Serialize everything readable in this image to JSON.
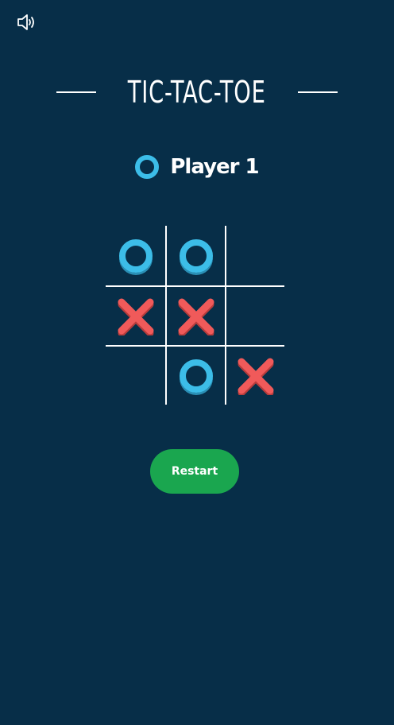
{
  "header": {
    "title": "TIC-TAC-TOE",
    "sound_icon": "speaker-volume-icon"
  },
  "turn": {
    "symbol": "O",
    "label": "Player 1"
  },
  "board": [
    [
      "O",
      "O",
      ""
    ],
    [
      "X",
      "X",
      ""
    ],
    [
      "",
      "O",
      "X"
    ]
  ],
  "controls": {
    "restart_label": "Restart"
  },
  "colors": {
    "background": "#072e48",
    "o_mark": "#3cbde8",
    "x_mark": "#f05a5a",
    "restart": "#1aa64f",
    "lines": "#ffffff"
  }
}
